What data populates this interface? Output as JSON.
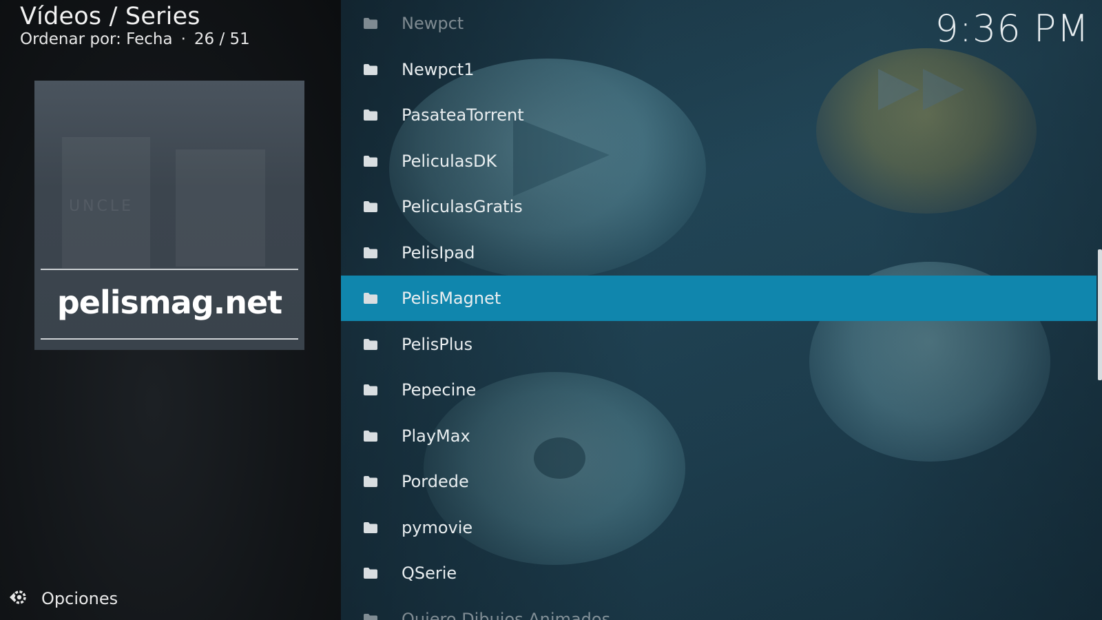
{
  "header": {
    "title": "Vídeos / Series",
    "sort_label": "Ordenar por: Fecha",
    "separator": "·",
    "position": "26 / 51"
  },
  "thumbnail": {
    "logo_text": "pelismag.net",
    "faded_text": "UNCLE"
  },
  "clock": "9:36 PM",
  "options": {
    "label": "Opciones",
    "icon": "gear-icon"
  },
  "list": {
    "items": [
      {
        "label": "Newpct",
        "icon": "folder-icon"
      },
      {
        "label": "Newpct1",
        "icon": "folder-icon"
      },
      {
        "label": "PasateaTorrent",
        "icon": "folder-icon"
      },
      {
        "label": "PeliculasDK",
        "icon": "folder-icon"
      },
      {
        "label": "PeliculasGratis",
        "icon": "folder-icon"
      },
      {
        "label": "PelisIpad",
        "icon": "folder-icon"
      },
      {
        "label": "PelisMagnet",
        "icon": "folder-icon"
      },
      {
        "label": "PelisPlus",
        "icon": "folder-icon"
      },
      {
        "label": "Pepecine",
        "icon": "folder-icon"
      },
      {
        "label": "PlayMax",
        "icon": "folder-icon"
      },
      {
        "label": "Pordede",
        "icon": "folder-icon"
      },
      {
        "label": "pymovie",
        "icon": "folder-icon"
      },
      {
        "label": "QSerie",
        "icon": "folder-icon"
      },
      {
        "label": "Quiero Dibujos Animados",
        "icon": "folder-icon"
      }
    ],
    "selected_label": "PelisMagnet"
  },
  "colors": {
    "accent": "#1086ad",
    "background_left": "#121518",
    "background_right": "#244a5c"
  }
}
